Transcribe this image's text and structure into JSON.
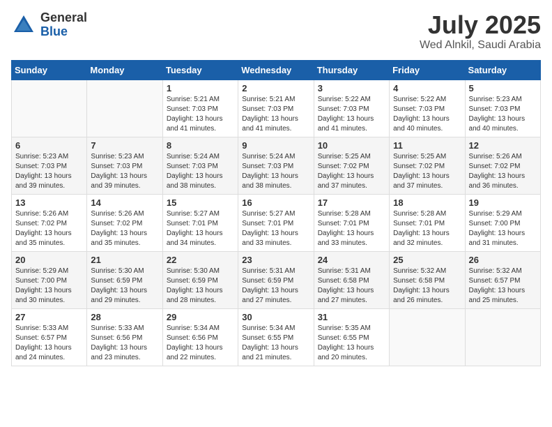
{
  "logo": {
    "general": "General",
    "blue": "Blue"
  },
  "title": {
    "month": "July 2025",
    "location": "Wed Alnkil, Saudi Arabia"
  },
  "weekdays": [
    "Sunday",
    "Monday",
    "Tuesday",
    "Wednesday",
    "Thursday",
    "Friday",
    "Saturday"
  ],
  "weeks": [
    [
      {
        "day": "",
        "info": ""
      },
      {
        "day": "",
        "info": ""
      },
      {
        "day": "1",
        "info": "Sunrise: 5:21 AM\nSunset: 7:03 PM\nDaylight: 13 hours and 41 minutes."
      },
      {
        "day": "2",
        "info": "Sunrise: 5:21 AM\nSunset: 7:03 PM\nDaylight: 13 hours and 41 minutes."
      },
      {
        "day": "3",
        "info": "Sunrise: 5:22 AM\nSunset: 7:03 PM\nDaylight: 13 hours and 41 minutes."
      },
      {
        "day": "4",
        "info": "Sunrise: 5:22 AM\nSunset: 7:03 PM\nDaylight: 13 hours and 40 minutes."
      },
      {
        "day": "5",
        "info": "Sunrise: 5:23 AM\nSunset: 7:03 PM\nDaylight: 13 hours and 40 minutes."
      }
    ],
    [
      {
        "day": "6",
        "info": "Sunrise: 5:23 AM\nSunset: 7:03 PM\nDaylight: 13 hours and 39 minutes."
      },
      {
        "day": "7",
        "info": "Sunrise: 5:23 AM\nSunset: 7:03 PM\nDaylight: 13 hours and 39 minutes."
      },
      {
        "day": "8",
        "info": "Sunrise: 5:24 AM\nSunset: 7:03 PM\nDaylight: 13 hours and 38 minutes."
      },
      {
        "day": "9",
        "info": "Sunrise: 5:24 AM\nSunset: 7:03 PM\nDaylight: 13 hours and 38 minutes."
      },
      {
        "day": "10",
        "info": "Sunrise: 5:25 AM\nSunset: 7:02 PM\nDaylight: 13 hours and 37 minutes."
      },
      {
        "day": "11",
        "info": "Sunrise: 5:25 AM\nSunset: 7:02 PM\nDaylight: 13 hours and 37 minutes."
      },
      {
        "day": "12",
        "info": "Sunrise: 5:26 AM\nSunset: 7:02 PM\nDaylight: 13 hours and 36 minutes."
      }
    ],
    [
      {
        "day": "13",
        "info": "Sunrise: 5:26 AM\nSunset: 7:02 PM\nDaylight: 13 hours and 35 minutes."
      },
      {
        "day": "14",
        "info": "Sunrise: 5:26 AM\nSunset: 7:02 PM\nDaylight: 13 hours and 35 minutes."
      },
      {
        "day": "15",
        "info": "Sunrise: 5:27 AM\nSunset: 7:01 PM\nDaylight: 13 hours and 34 minutes."
      },
      {
        "day": "16",
        "info": "Sunrise: 5:27 AM\nSunset: 7:01 PM\nDaylight: 13 hours and 33 minutes."
      },
      {
        "day": "17",
        "info": "Sunrise: 5:28 AM\nSunset: 7:01 PM\nDaylight: 13 hours and 33 minutes."
      },
      {
        "day": "18",
        "info": "Sunrise: 5:28 AM\nSunset: 7:01 PM\nDaylight: 13 hours and 32 minutes."
      },
      {
        "day": "19",
        "info": "Sunrise: 5:29 AM\nSunset: 7:00 PM\nDaylight: 13 hours and 31 minutes."
      }
    ],
    [
      {
        "day": "20",
        "info": "Sunrise: 5:29 AM\nSunset: 7:00 PM\nDaylight: 13 hours and 30 minutes."
      },
      {
        "day": "21",
        "info": "Sunrise: 5:30 AM\nSunset: 6:59 PM\nDaylight: 13 hours and 29 minutes."
      },
      {
        "day": "22",
        "info": "Sunrise: 5:30 AM\nSunset: 6:59 PM\nDaylight: 13 hours and 28 minutes."
      },
      {
        "day": "23",
        "info": "Sunrise: 5:31 AM\nSunset: 6:59 PM\nDaylight: 13 hours and 27 minutes."
      },
      {
        "day": "24",
        "info": "Sunrise: 5:31 AM\nSunset: 6:58 PM\nDaylight: 13 hours and 27 minutes."
      },
      {
        "day": "25",
        "info": "Sunrise: 5:32 AM\nSunset: 6:58 PM\nDaylight: 13 hours and 26 minutes."
      },
      {
        "day": "26",
        "info": "Sunrise: 5:32 AM\nSunset: 6:57 PM\nDaylight: 13 hours and 25 minutes."
      }
    ],
    [
      {
        "day": "27",
        "info": "Sunrise: 5:33 AM\nSunset: 6:57 PM\nDaylight: 13 hours and 24 minutes."
      },
      {
        "day": "28",
        "info": "Sunrise: 5:33 AM\nSunset: 6:56 PM\nDaylight: 13 hours and 23 minutes."
      },
      {
        "day": "29",
        "info": "Sunrise: 5:34 AM\nSunset: 6:56 PM\nDaylight: 13 hours and 22 minutes."
      },
      {
        "day": "30",
        "info": "Sunrise: 5:34 AM\nSunset: 6:55 PM\nDaylight: 13 hours and 21 minutes."
      },
      {
        "day": "31",
        "info": "Sunrise: 5:35 AM\nSunset: 6:55 PM\nDaylight: 13 hours and 20 minutes."
      },
      {
        "day": "",
        "info": ""
      },
      {
        "day": "",
        "info": ""
      }
    ]
  ]
}
